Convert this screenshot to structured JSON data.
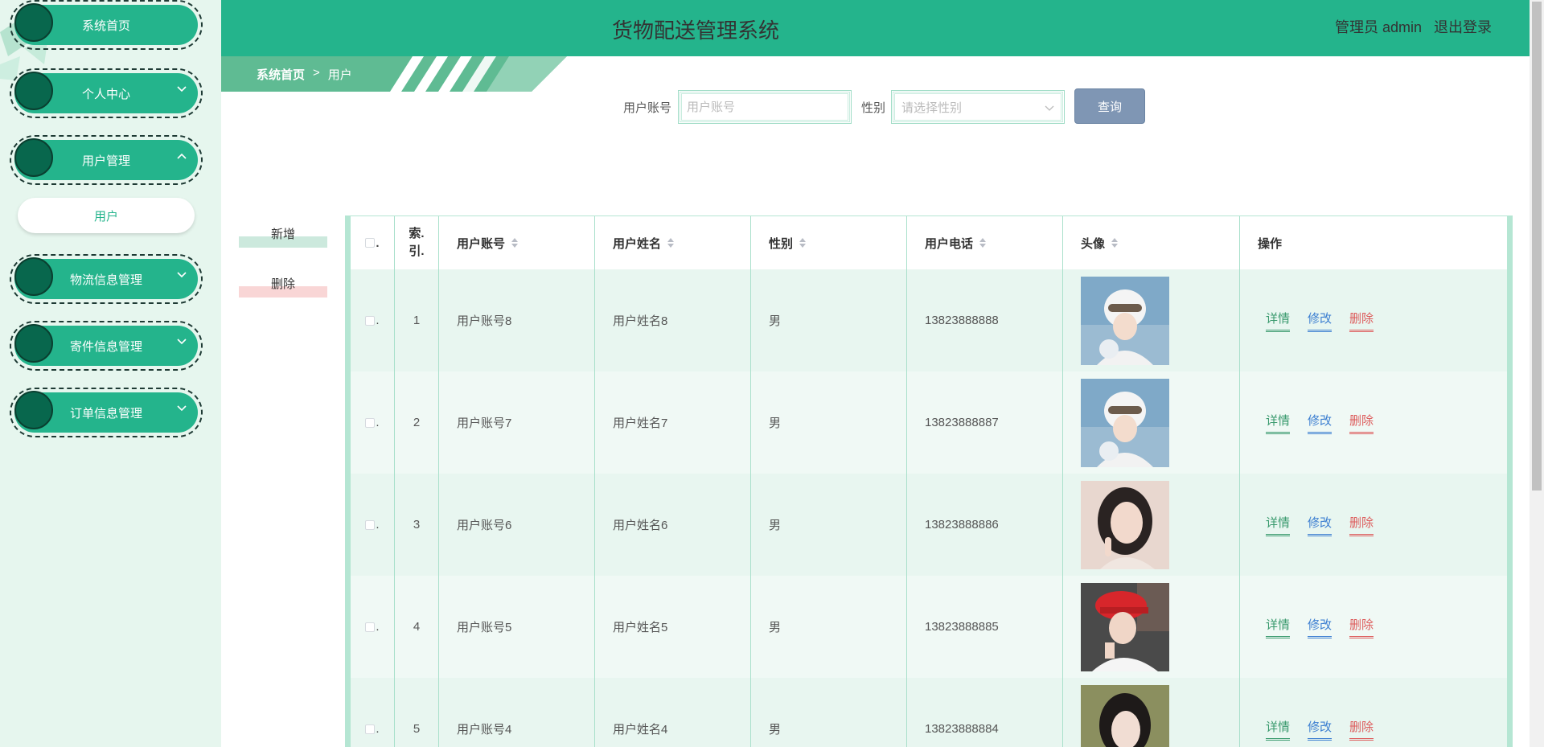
{
  "header": {
    "title": "货物配送管理系统",
    "admin_label": "管理员 admin",
    "logout_label": "退出登录"
  },
  "sidebar": {
    "items": [
      {
        "label": "系统首页",
        "has_chevron": false
      },
      {
        "label": "个人中心",
        "has_chevron": true,
        "chevron": "down"
      },
      {
        "label": "用户管理",
        "has_chevron": true,
        "chevron": "up"
      },
      {
        "label": "物流信息管理",
        "has_chevron": true,
        "chevron": "down"
      },
      {
        "label": "寄件信息管理",
        "has_chevron": true,
        "chevron": "down"
      },
      {
        "label": "订单信息管理",
        "has_chevron": true,
        "chevron": "down"
      }
    ],
    "submenu": {
      "label": "用户"
    }
  },
  "breadcrumb": {
    "home": "系统首页",
    "separator": ">",
    "current": "用户"
  },
  "search": {
    "account_label": "用户账号",
    "account_placeholder": "用户账号",
    "gender_label": "性别",
    "gender_placeholder": "请选择性别",
    "query_label": "查询"
  },
  "actions": {
    "add_label": "新增",
    "delete_label": "删除"
  },
  "table": {
    "columns": [
      "索引",
      "用户账号",
      "用户姓名",
      "性别",
      "用户电话",
      "头像",
      "操作"
    ],
    "index_header_line1": "索.",
    "index_header_line2": "引.",
    "checkbox_suffix": ".",
    "row_ops": {
      "detail": "详情",
      "edit": "修改",
      "delete": "删除"
    },
    "rows": [
      {
        "index": "1",
        "account": "用户账号8",
        "name": "用户姓名8",
        "gender": "男",
        "phone": "13823888888",
        "avatar": "girl-white-helmet"
      },
      {
        "index": "2",
        "account": "用户账号7",
        "name": "用户姓名7",
        "gender": "男",
        "phone": "13823888887",
        "avatar": "girl-white-helmet"
      },
      {
        "index": "3",
        "account": "用户账号6",
        "name": "用户姓名6",
        "gender": "男",
        "phone": "13823888886",
        "avatar": "girl-portrait"
      },
      {
        "index": "4",
        "account": "用户账号5",
        "name": "用户姓名5",
        "gender": "男",
        "phone": "13823888885",
        "avatar": "boy-red-cap"
      },
      {
        "index": "5",
        "account": "用户账号4",
        "name": "用户姓名4",
        "gender": "男",
        "phone": "13823888884",
        "avatar": "girl-school-uniform"
      }
    ]
  },
  "colors": {
    "primary": "#24b48c",
    "dark_green": "#08674d",
    "sidebar_bg": "#e6f6ee",
    "row_even": "#e8f6f0",
    "row_odd": "#f0f9f5",
    "query_button": "#7f96b4",
    "detail": "#3a9a6e",
    "edit": "#3d7fd1",
    "delete": "#dd5b5b"
  }
}
